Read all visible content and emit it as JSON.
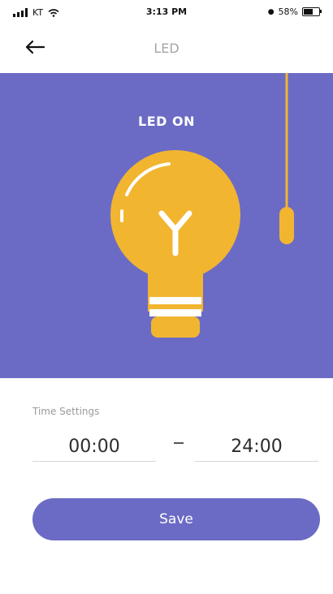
{
  "status_bar": {
    "carrier": "KT",
    "time": "3:13 PM",
    "battery": "58%"
  },
  "nav": {
    "title": "LED"
  },
  "hero": {
    "status_text": "LED ON",
    "background_color": "#6b6bc5",
    "bulb_color": "#f2b530"
  },
  "time_settings": {
    "label": "Time Settings",
    "start": "00:00",
    "end": "24:00"
  },
  "save_label": "Save"
}
